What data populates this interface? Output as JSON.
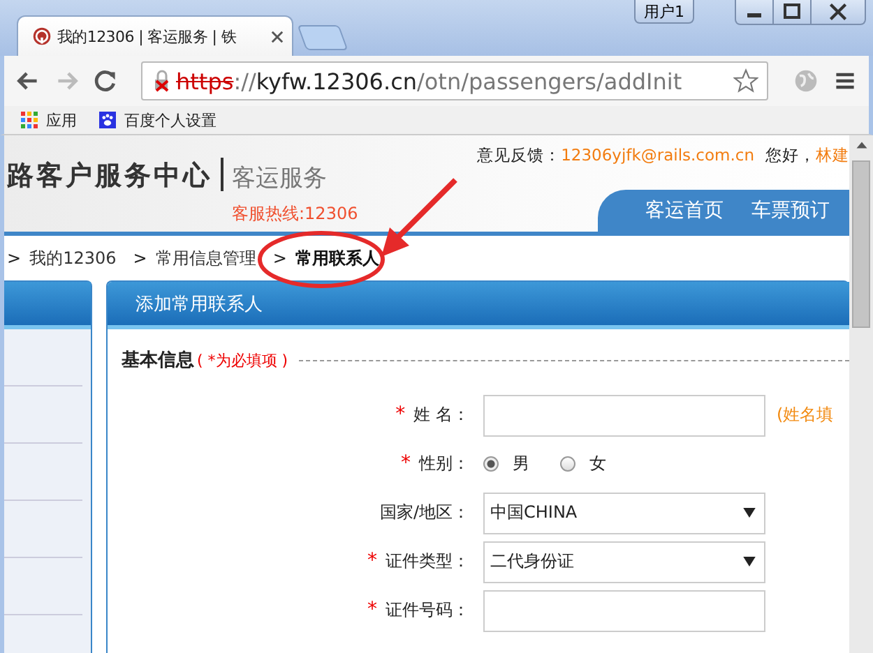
{
  "browser": {
    "tab_title": "我的12306 | 客运服务 | 铁",
    "user_button": "用户1",
    "url_parts": [
      {
        "text": "https",
        "kind": "insecure"
      },
      {
        "text": "://",
        "kind": "dim"
      },
      {
        "text": "kyfw.12306.cn",
        "kind": "host"
      },
      {
        "text": "/otn/passengers/addInit",
        "kind": "dim"
      }
    ],
    "bookmarks": [
      {
        "label": "应用",
        "kind": "apps"
      },
      {
        "label": "百度个人设置",
        "kind": "paw"
      }
    ]
  },
  "header": {
    "logo": "路客户服务中心",
    "service": "客运服务",
    "hotline": "客服热线:12306",
    "feedback_label": "意见反馈：",
    "feedback_email": "12306yjfk@rails.com.cn",
    "greeting": "您好，",
    "user_name": "林建",
    "nav": [
      "客运首页",
      "车票预订"
    ]
  },
  "breadcrumb": [
    {
      "sep": ">",
      "label": "我的12306",
      "current": false
    },
    {
      "sep": ">",
      "label": "常用信息管理",
      "current": false
    },
    {
      "sep": ">",
      "label": "常用联系人",
      "current": true
    }
  ],
  "panel": {
    "title": "添加常用联系人",
    "section_title": "基本信息",
    "section_note": "( *为必填项 )",
    "required_mark": "*",
    "fields": [
      {
        "kind": "input",
        "label": "姓 名：",
        "required": true,
        "hint": "(姓名填"
      },
      {
        "kind": "radio",
        "label": "性别：",
        "required": true,
        "options": [
          {
            "label": "男",
            "selected": true
          },
          {
            "label": "女",
            "selected": false
          }
        ]
      },
      {
        "kind": "select",
        "label": "国家/地区：",
        "required": false,
        "value": "中国CHINA"
      },
      {
        "kind": "select",
        "label": "证件类型：",
        "required": true,
        "value": "二代身份证"
      },
      {
        "kind": "input",
        "label": "证件号码：",
        "required": true
      }
    ]
  }
}
